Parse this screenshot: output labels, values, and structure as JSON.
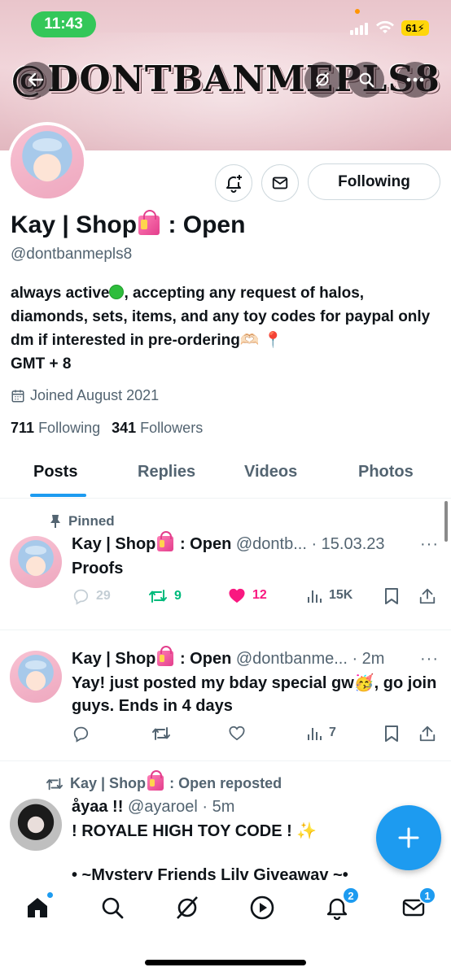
{
  "status_bar": {
    "time": "11:43",
    "battery": "61"
  },
  "banner": {
    "title": "@DONTBANMEPLS8"
  },
  "profile": {
    "display_name": "Kay | Shop",
    "display_name_suffix": ": Open",
    "handle": "@dontbanmepls8",
    "bio_part1": "always active",
    "bio_part2": ", accepting any request of halos, diamonds, sets, items, and any toy codes for paypal only dm if interested in pre-ordering",
    "bio_part3": "🫶🏻 📍",
    "bio_part4": "GMT + 8",
    "joined": "Joined August 2021",
    "following_count": "711",
    "following_label": "Following",
    "followers_count": "341",
    "followers_label": "Followers",
    "follow_button": "Following"
  },
  "tabs": [
    {
      "label": "Posts",
      "active": true
    },
    {
      "label": "Replies"
    },
    {
      "label": "Videos"
    },
    {
      "label": "Photos"
    }
  ],
  "posts": [
    {
      "pinned_label": "Pinned",
      "name": "Kay | Shop",
      "name_suffix": ": Open",
      "handle_time": "@dontb... · 15.03.23",
      "text": "Proofs",
      "replies": "29",
      "reposts": "9",
      "likes": "12",
      "views": "15K"
    },
    {
      "name": "Kay | Shop",
      "name_suffix": ": Open",
      "handle_time": "@dontbanme... · 2m",
      "text": "Yay! just posted my bday special gw🥳, go join guys. Ends in 4 days",
      "replies": "",
      "reposts": "",
      "likes": "",
      "views": "7"
    },
    {
      "repost_by": "Kay | Shop",
      "repost_suffix": ": Open reposted",
      "name": "åyaa !!",
      "handle_time": "@ayaroel · 5m",
      "text_line1": "! ROYALE HIGH TOY CODE ! ✨",
      "text_line2": "• ~Mysterv Friends Lilv Giveawav ~•"
    }
  ],
  "nav": {
    "notifications_badge": "2",
    "messages_badge": "1"
  },
  "colors": {
    "accent": "#1d9bf0",
    "like": "#f91880",
    "repost": "#00ba7c",
    "muted": "#536471"
  }
}
